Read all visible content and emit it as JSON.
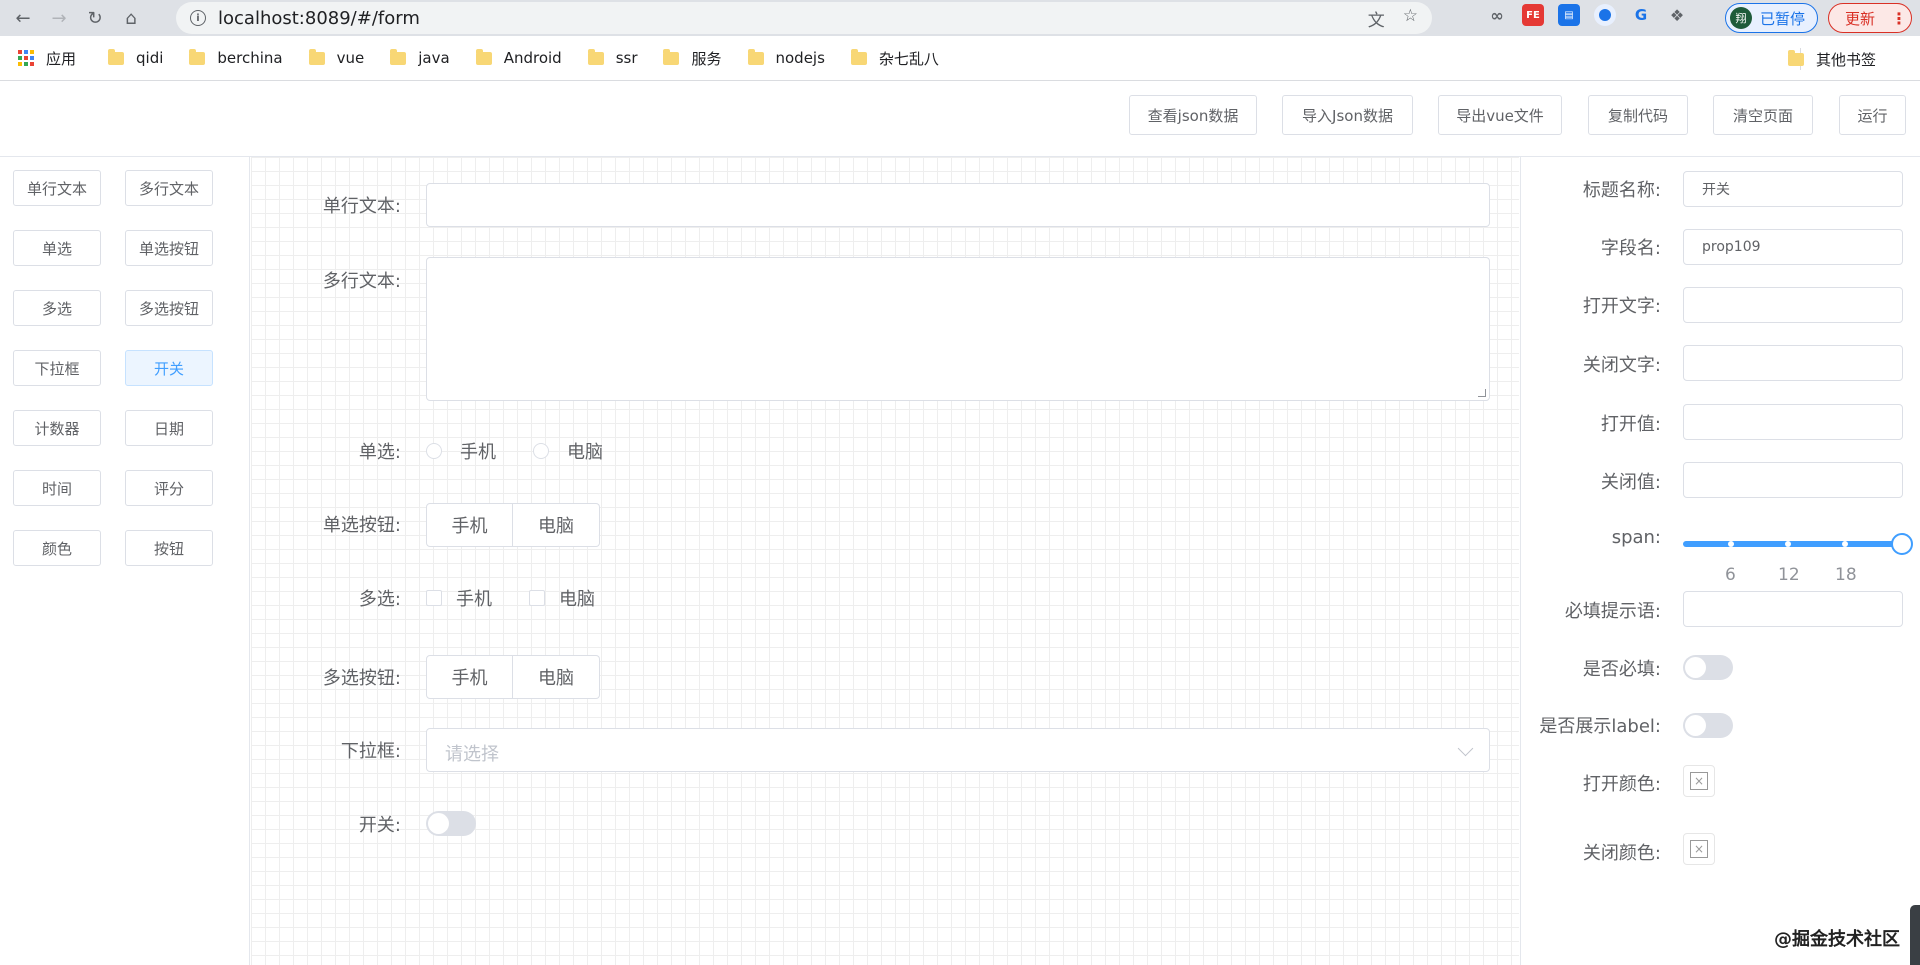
{
  "browser": {
    "url": "localhost:8089/#/form",
    "profile_initial": "翔",
    "profile_label": "已暂停",
    "update_label": "更新",
    "ext_fe": "FE"
  },
  "bookmarks": {
    "apps_label": "应用",
    "items": [
      "qidi",
      "berchina",
      "vue",
      "java",
      "Android",
      "ssr",
      "服务",
      "nodejs",
      "杂七乱八"
    ],
    "other_label": "其他书签"
  },
  "toolbar": {
    "view_json": "查看json数据",
    "import_json": "导入Json数据",
    "export_vue": "导出vue文件",
    "copy_code": "复制代码",
    "clear_page": "清空页面",
    "run": "运行"
  },
  "components": [
    "单行文本",
    "多行文本",
    "单选",
    "单选按钮",
    "多选",
    "多选按钮",
    "下拉框",
    "开关",
    "计数器",
    "日期",
    "时间",
    "评分",
    "颜色",
    "按钮"
  ],
  "form": {
    "single_text_label": "单行文本:",
    "multi_text_label": "多行文本:",
    "radio_label": "单选:",
    "radio_options": [
      "手机",
      "电脑"
    ],
    "radio_button_label": "单选按钮:",
    "radio_button_options": [
      "手机",
      "电脑"
    ],
    "checkbox_label": "多选:",
    "checkbox_options": [
      "手机",
      "电脑"
    ],
    "checkbox_button_label": "多选按钮:",
    "checkbox_button_options": [
      "手机",
      "电脑"
    ],
    "select_label": "下拉框:",
    "select_placeholder": "请选择",
    "switch_label": "开关:"
  },
  "props": {
    "title_label": "标题名称:",
    "title_value": "开关",
    "field_label": "字段名:",
    "field_value": "prop109",
    "on_text_label": "打开文字:",
    "off_text_label": "关闭文字:",
    "on_value_label": "打开值:",
    "off_value_label": "关闭值:",
    "span_label": "span:",
    "span_marks": [
      "6",
      "12",
      "18"
    ],
    "span_value": 24,
    "required_msg_label": "必填提示语:",
    "required_label": "是否必填:",
    "show_label_label": "是否展示label:",
    "on_color_label": "打开颜色:",
    "off_color_label": "关闭颜色:"
  },
  "watermark": "@掘金技术社区"
}
